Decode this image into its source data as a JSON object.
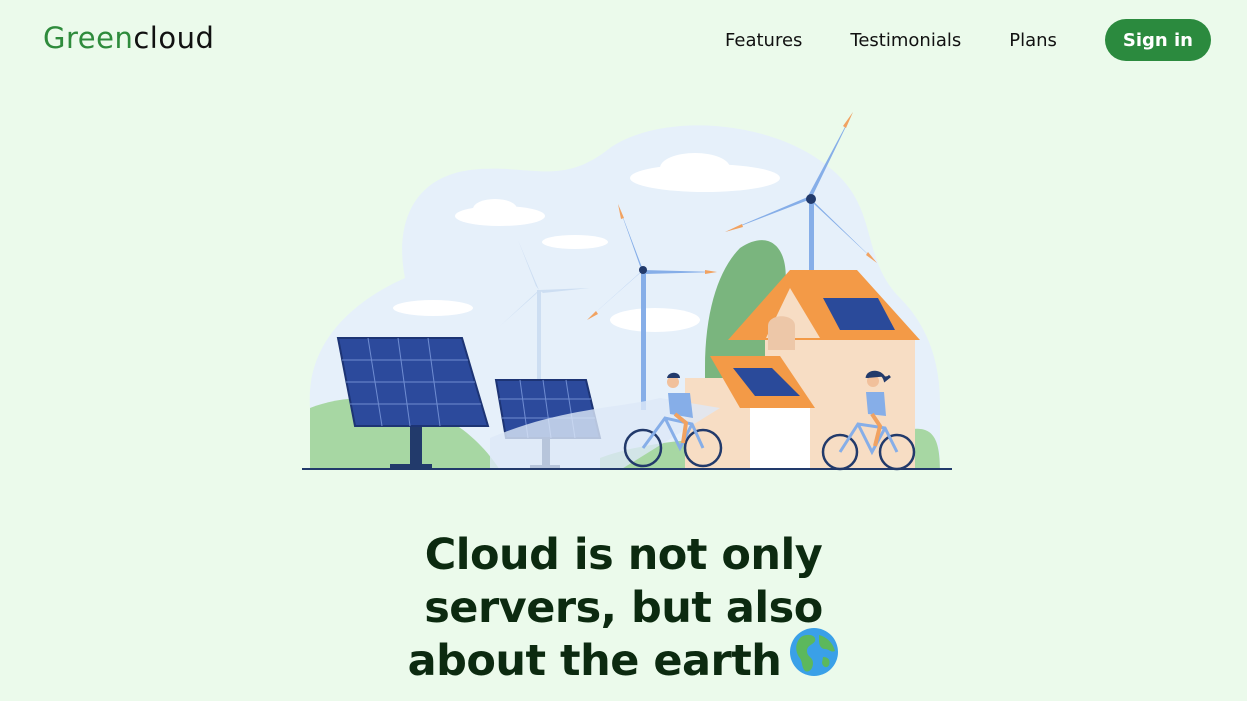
{
  "header": {
    "logo_part1": "Green",
    "logo_part2": "cloud",
    "nav": {
      "features": "Features",
      "testimonials": "Testimonials",
      "plans": "Plans",
      "signin": "Sign in"
    }
  },
  "hero": {
    "line1": "Cloud is not only",
    "line2": "servers, but also",
    "line3": "about the earth"
  },
  "colors": {
    "background": "#ebfaeb",
    "brand_green": "#2b8a3e",
    "heading": "#0c2a10"
  },
  "icons": {
    "globe": "globe-europe-africa-icon",
    "illustration": "renewable-energy-illustration"
  }
}
